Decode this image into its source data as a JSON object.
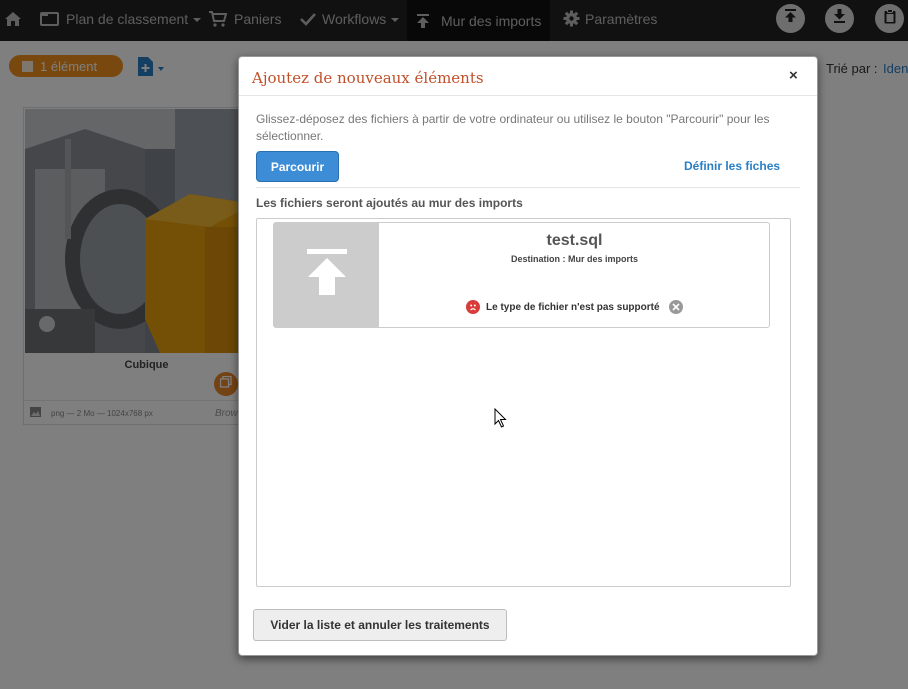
{
  "navbar": {
    "items": [
      {
        "label": "Plan de classement",
        "icon": "folder-icon",
        "dropdown": true
      },
      {
        "label": "Paniers",
        "icon": "cart-icon",
        "dropdown": false
      },
      {
        "label": "Workflows",
        "icon": "check-icon",
        "dropdown": true
      },
      {
        "label": "Mur des imports",
        "icon": "upload-icon",
        "dropdown": false,
        "active": true
      },
      {
        "label": "Paramètres",
        "icon": "gear-icon",
        "dropdown": false
      }
    ],
    "right_icons": [
      "upload-circle-icon",
      "download-circle-icon",
      "clipboard-circle-icon"
    ]
  },
  "page": {
    "selection_count": "1 élément",
    "sort_label": "Trié par :",
    "sort_value": "Iden",
    "card": {
      "title": "Cubique",
      "meta": "png — 2 Mo — 1024x768 px",
      "browse_label": "Brow"
    }
  },
  "modal": {
    "title": "Ajoutez de nouveaux éléments",
    "close_label": "×",
    "intro": "Glissez-déposez des fichiers à partir de votre ordinateur ou utilisez le bouton \"Parcourir\" pour les sélectionner.",
    "browse_button": "Parcourir",
    "define_link": "Définir les fiches",
    "files_heading": "Les fichiers seront ajoutés au mur des imports",
    "files": [
      {
        "name": "test.sql",
        "destination": "Destination : Mur des imports",
        "error": "Le type de fichier n'est pas supporté"
      }
    ],
    "clear_button": "Vider la liste et annuler les traitements"
  },
  "colors": {
    "navbar_bg": "#222222",
    "accent_orange": "#f0901e",
    "primary_blue": "#3c8dd6",
    "title_red": "#c0502a",
    "error_red": "#d93b3b"
  }
}
